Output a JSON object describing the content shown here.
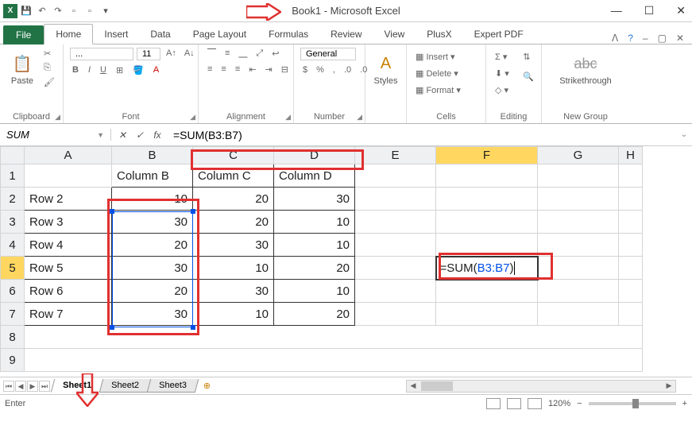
{
  "title": "Book1 - Microsoft Excel",
  "tabs": {
    "file": "File",
    "home": "Home",
    "insert": "Insert",
    "data": "Data",
    "layout": "Page Layout",
    "formulas": "Formulas",
    "review": "Review",
    "view": "View",
    "plusx": "PlusX",
    "expert": "Expert PDF"
  },
  "groups": {
    "clipboard": "Clipboard",
    "paste": "Paste",
    "font": "Font",
    "font_family": "...",
    "font_size": "11",
    "alignment": "Alignment",
    "number": "Number",
    "number_format": "General",
    "styles": "Styles",
    "cells": "Cells",
    "insert_btn": "Insert",
    "delete_btn": "Delete",
    "format_btn": "Format",
    "editing": "Editing",
    "newgroup": "New Group",
    "strike": "Strikethrough"
  },
  "name_box": "SUM",
  "formula_bar": "=SUM(B3:B7)",
  "columns": [
    "A",
    "B",
    "C",
    "D",
    "E",
    "F",
    "G",
    "H"
  ],
  "headers": {
    "b": "Column B",
    "c": "Column C",
    "d": "Column D"
  },
  "rows": [
    {
      "n": "2",
      "label": "Row 2",
      "b": "10",
      "c": "20",
      "d": "30"
    },
    {
      "n": "3",
      "label": "Row 3",
      "b": "30",
      "c": "20",
      "d": "10"
    },
    {
      "n": "4",
      "label": "Row 4",
      "b": "20",
      "c": "30",
      "d": "10"
    },
    {
      "n": "5",
      "label": "Row 5",
      "b": "30",
      "c": "10",
      "d": "20"
    },
    {
      "n": "6",
      "label": "Row 6",
      "b": "20",
      "c": "30",
      "d": "10"
    },
    {
      "n": "7",
      "label": "Row 7",
      "b": "30",
      "c": "10",
      "d": "20"
    }
  ],
  "active_cell_formula_prefix": "=SUM(",
  "active_cell_formula_ref": "B3:B7",
  "active_cell_formula_suffix": ")",
  "sheets": [
    "Sheet1",
    "Sheet2",
    "Sheet3"
  ],
  "status": {
    "mode": "Enter",
    "zoom": "120%"
  },
  "zoom_btns": {
    "minus": "−",
    "plus": "+"
  }
}
